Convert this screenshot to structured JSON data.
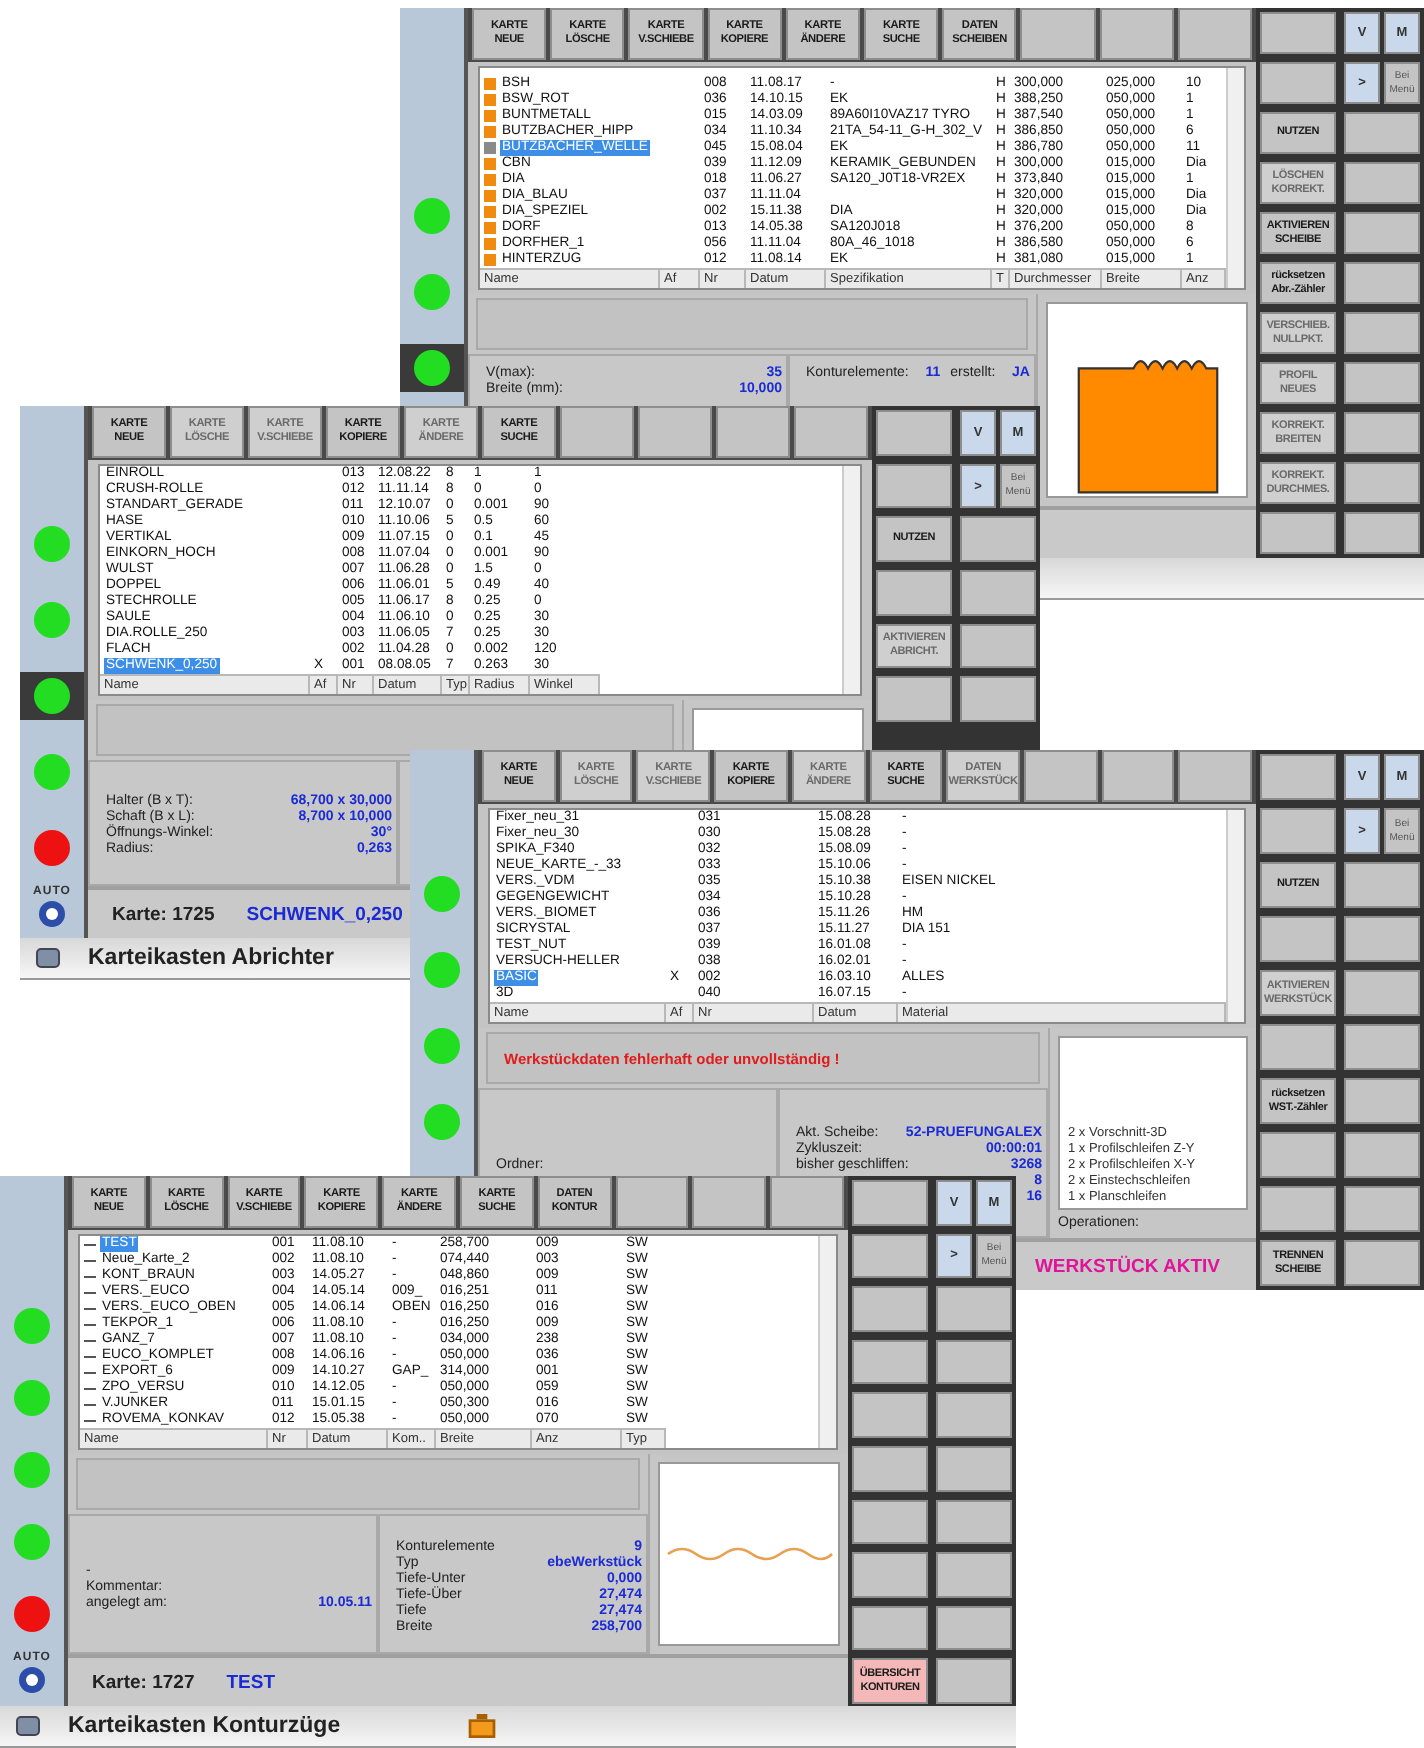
{
  "windows": [
    {
      "lights": [
        {
          "color": "#22dd22",
          "active": false
        },
        {
          "color": "#22dd22",
          "active": false
        },
        {
          "color": "#22dd22",
          "active": true
        }
      ],
      "panels": [
        {
          "rows": [
            [
              {
                "label": "V(max):",
                "value": "35"
              }
            ],
            [
              {
                "label": "Breite (mm):",
                "value": "10,000"
              }
            ]
          ]
        },
        {
          "rows": [
            [
              {
                "label": "Konturelemente:",
                "value": "11"
              },
              {
                "label": "erstellt:",
                "value": "JA"
              }
            ]
          ]
        }
      ],
      "drawing": {
        "kind": "profile"
      },
      "table": {
        "rows": [
          {
            "cells": [
              "BSH",
              null,
              "008",
              "11.08.17",
              "-",
              "H",
              "300,000",
              "025,000",
              "10"
            ],
            "selected": false
          },
          {
            "cells": [
              "BSW_ROT",
              null,
              "036",
              "14.10.15",
              "EK",
              "H",
              "388,250",
              "050,000",
              "1"
            ],
            "selected": false
          },
          {
            "cells": [
              "BUNTMETALL",
              null,
              "015",
              "14.03.09",
              "89A60I10VAZ17 TYRO",
              "H",
              "387,540",
              "050,000",
              "1"
            ],
            "selected": false
          },
          {
            "cells": [
              "BUTZBACHER_HIPP",
              null,
              "034",
              "11.10.34",
              "21TA_54-11_G-H_302_V",
              "H",
              "386,850",
              "050,000",
              "6"
            ],
            "selected": false
          },
          {
            "cells": [
              "BUTZBACHER_WELLE",
              null,
              "045",
              "15.08.04",
              "EK",
              "H",
              "386,780",
              "050,000",
              "11"
            ],
            "selected": true
          },
          {
            "cells": [
              "CBN",
              null,
              "039",
              "11.12.09",
              "KERAMIK_GEBUNDEN",
              "H",
              "300,000",
              "015,000",
              "Dia"
            ],
            "selected": false
          },
          {
            "cells": [
              "DIA",
              null,
              "018",
              "11.06.27",
              "SA120_J0T18-VR2EX",
              "H",
              "373,840",
              "015,000",
              "1"
            ],
            "selected": false
          },
          {
            "cells": [
              "DIA_BLAU",
              null,
              "037",
              "11.11.04",
              null,
              "H",
              "320,000",
              "015,000",
              "Dia"
            ],
            "selected": false
          },
          {
            "cells": [
              "DIA_SPEZIEL",
              null,
              "002",
              "15.11.38",
              "DIA",
              "H",
              "320,000",
              "015,000",
              "Dia"
            ],
            "selected": false
          },
          {
            "cells": [
              "DORF",
              null,
              "013",
              "14.05.38",
              "SA120J018",
              "H",
              "376,200",
              "050,000",
              "8"
            ],
            "selected": false
          },
          {
            "cells": [
              "DORFHER_1",
              null,
              "056",
              "11.11.04",
              "80A_46_1018",
              "H",
              "386,580",
              "050,000",
              "6"
            ],
            "selected": false
          },
          {
            "cells": [
              "HINTERZUG",
              null,
              "012",
              "11.08.14",
              "EK",
              "H",
              "381,080",
              "015,000",
              "1"
            ],
            "selected": false
          }
        ],
        "heading_row": [
          "Name",
          "Af",
          "Nr",
          "Datum",
          "Spezifikation",
          "T",
          "Durchmesser",
          "Breite",
          "Anz"
        ]
      },
      "toolbar": [
        {
          "label": "KARTE\nNEUE",
          "disabled": false
        },
        {
          "label": "KARTE\nLÖSCHE",
          "disabled": false
        },
        {
          "label": "KARTE\nV.SCHIEBE",
          "disabled": false
        },
        {
          "label": "KARTE\nKOPIERE",
          "disabled": false
        },
        {
          "label": "KARTE\nÄNDERE",
          "disabled": false
        },
        {
          "label": "KARTE\nSUCHE",
          "disabled": false
        },
        {
          "label": "DATEN\nSCHEIBEN",
          "disabled": false
        }
      ],
      "side_buttons": [
        {
          "kind": "blank"
        },
        {
          "kind": "blank"
        },
        {
          "kind": "button",
          "label": "NUTZEN",
          "disabled": false
        },
        {
          "kind": "button",
          "label": "LÖSCHEN\nKORREKT.",
          "disabled": true
        },
        {
          "kind": "button",
          "label": "AKTIVIEREN\nSCHEIBE",
          "disabled": false
        },
        {
          "kind": "button",
          "label": "rücksetzen\nAbr.-Zähler",
          "disabled": false
        },
        {
          "kind": "button",
          "label": "VERSCHIEB.\nNULLPKT.",
          "disabled": true
        },
        {
          "kind": "button",
          "label": "PROFIL\nNEUES",
          "disabled": true
        },
        {
          "kind": "button",
          "label": "KORREKT.\nBREITEN",
          "disabled": true
        },
        {
          "kind": "button",
          "label": "KORREKT.\nDURCHMES.",
          "disabled": true
        },
        {
          "kind": "blank"
        }
      ],
      "nav": {
        "keys": [
          "V",
          "M"
        ],
        "arrow": ">",
        "menu": "Bei\nMenü"
      }
    },
    {
      "lights": [
        {
          "color": "#22dd22",
          "active": false
        },
        {
          "color": "#22dd22",
          "active": false
        },
        {
          "color": "#22dd22",
          "active": true
        },
        {
          "color": "#22dd22",
          "active": false
        },
        {
          "color": "#ee1111",
          "active": false
        }
      ],
      "mode": "AUTO",
      "panels": [
        {
          "rows": [
            [
              {
                "label": "Halter (B x T):",
                "value": "68,700 x 30,000"
              }
            ],
            [
              {
                "label": "Schaft (B x L):",
                "value": "8,700 x 10,000"
              }
            ],
            [
              {
                "label": "Öffnungs-Winkel:",
                "value": "30°"
              }
            ],
            [
              {
                "label": "Radius:",
                "value": "0,263"
              }
            ]
          ]
        }
      ],
      "drawing": {
        "kind": "frame"
      },
      "table": {
        "rows": [
          {
            "cells": [
              "EINROLL",
              null,
              "013",
              "12.08.22",
              "8",
              "1",
              "1"
            ],
            "selected": false
          },
          {
            "cells": [
              "CRUSH-ROLLE",
              null,
              "012",
              "11.11.14",
              "8",
              "0",
              "0"
            ],
            "selected": false
          },
          {
            "cells": [
              "STANDART_GERADE",
              null,
              "011",
              "12.10.07",
              "0",
              "0.001",
              "90"
            ],
            "selected": false
          },
          {
            "cells": [
              "HASE",
              null,
              "010",
              "11.10.06",
              "5",
              "0.5",
              "60"
            ],
            "selected": false
          },
          {
            "cells": [
              "VERTIKAL",
              null,
              "009",
              "11.07.15",
              "0",
              "0.1",
              "45"
            ],
            "selected": false
          },
          {
            "cells": [
              "EINKORN_HOCH",
              null,
              "008",
              "11.07.04",
              "0",
              "0.001",
              "90"
            ],
            "selected": false
          },
          {
            "cells": [
              "WULST",
              null,
              "007",
              "11.06.28",
              "0",
              "1.5",
              "0"
            ],
            "selected": false
          },
          {
            "cells": [
              "DOPPEL",
              null,
              "006",
              "11.06.01",
              "5",
              "0.49",
              "40"
            ],
            "selected": false
          },
          {
            "cells": [
              "STECHROLLE",
              null,
              "005",
              "11.06.17",
              "8",
              "0.25",
              "0"
            ],
            "selected": false
          },
          {
            "cells": [
              "SAULE",
              null,
              "004",
              "11.06.10",
              "0",
              "0.25",
              "30"
            ],
            "selected": false
          },
          {
            "cells": [
              "DIA.ROLLE_250",
              null,
              "003",
              "11.06.05",
              "7",
              "0.25",
              "30"
            ],
            "selected": false
          },
          {
            "cells": [
              "FLACH",
              null,
              "002",
              "11.04.28",
              "0",
              "0.002",
              "120"
            ],
            "selected": false
          },
          {
            "cells": [
              "SCHWENK_0,250",
              "X",
              "001",
              "08.08.05",
              "7",
              "0.263",
              "30"
            ],
            "selected": true
          }
        ],
        "heading_row": [
          "Name",
          "Af",
          "Nr",
          "Datum",
          "Typ",
          "Radius",
          "Winkel"
        ]
      },
      "toolbar": [
        {
          "label": "KARTE\nNEUE",
          "disabled": false
        },
        {
          "label": "KARTE\nLÖSCHE",
          "disabled": true
        },
        {
          "label": "KARTE\nV.SCHIEBE",
          "disabled": true
        },
        {
          "label": "KARTE\nKOPIERE",
          "disabled": false
        },
        {
          "label": "KARTE\nÄNDERE",
          "disabled": true
        },
        {
          "label": "KARTE\nSUCHE",
          "disabled": false
        }
      ],
      "side_buttons": [
        {
          "kind": "blank"
        },
        {
          "kind": "blank"
        },
        {
          "kind": "button",
          "label": "NUTZEN",
          "disabled": false
        },
        {
          "kind": "blank"
        },
        {
          "kind": "button",
          "label": "AKTIVIEREN\nABRICHT.",
          "disabled": true
        },
        {
          "kind": "blank"
        }
      ],
      "nav": {
        "keys": [
          "V",
          "M"
        ],
        "arrow": ">",
        "menu": "Bei\nMenü"
      },
      "card": {
        "label": "Karte: 1725",
        "name": "SCHWENK_0,250"
      },
      "title": {
        "text": "Karteikasten Abrichter"
      }
    },
    {
      "lights": [
        {
          "color": "#22dd22",
          "active": false
        },
        {
          "color": "#22dd22",
          "active": false
        },
        {
          "color": "#22dd22",
          "active": false
        },
        {
          "color": "#22dd22",
          "active": false
        }
      ],
      "table": {
        "rows": [
          {
            "cells": [
              "Fixer_neu_31",
              null,
              "031",
              "15.08.28",
              "-"
            ],
            "selected": false
          },
          {
            "cells": [
              "Fixer_neu_30",
              null,
              "030",
              "15.08.28",
              "-"
            ],
            "selected": false
          },
          {
            "cells": [
              "SPIKA_F340",
              null,
              "032",
              "15.08.09",
              "-"
            ],
            "selected": false
          },
          {
            "cells": [
              "NEUE_KARTE_-_33",
              null,
              "033",
              "15.10.06",
              "-"
            ],
            "selected": false
          },
          {
            "cells": [
              "VERS._VDM",
              null,
              "035",
              "15.10.38",
              "EISEN NICKEL"
            ],
            "selected": false
          },
          {
            "cells": [
              "GEGENGEWICHT",
              null,
              "034",
              "15.10.28",
              "-"
            ],
            "selected": false
          },
          {
            "cells": [
              "VERS._BIOMET",
              null,
              "036",
              "15.11.26",
              "HM"
            ],
            "selected": false
          },
          {
            "cells": [
              "SICRYSTAL",
              null,
              "037",
              "15.11.27",
              "DIA 151"
            ],
            "selected": false
          },
          {
            "cells": [
              "TEST_NUT",
              null,
              "039",
              "16.01.08",
              "-"
            ],
            "selected": false
          },
          {
            "cells": [
              "VERSUCH-HELLER",
              null,
              "038",
              "16.02.01",
              "-"
            ],
            "selected": false
          },
          {
            "cells": [
              "BASIC",
              "X",
              "002",
              "16.03.10",
              "ALLES"
            ],
            "selected": true
          },
          {
            "cells": [
              "3D",
              null,
              "040",
              "16.07.15",
              "-"
            ],
            "selected": false
          }
        ],
        "heading_row": [
          "Name",
          "Af",
          "Nr",
          "Datum",
          "Material"
        ]
      },
      "message": "Werkstückdaten fehlerhaft oder unvollständig !",
      "panels": [
        {
          "rows": [
            [
              {
                "label": "Ordner:"
              }
            ]
          ]
        },
        {
          "rows": [
            [
              {
                "label": "Akt. Scheibe:",
                "value": "52-PRUEFUNGALEX"
              }
            ],
            [
              {
                "label": "Zykluszeit:",
                "value": "00:00:01"
              }
            ],
            [
              {
                "label": "bisher geschliffen:",
                "value": "3268"
              }
            ],
            [
              {
                "value": "8"
              }
            ],
            [
              {
                "value": "16"
              }
            ]
          ]
        }
      ],
      "drawing": {
        "kind": "operations",
        "lines": [
          "2 x Vorschnitt-3D",
          "1 x Profilschleifen Z-Y",
          "2 x Profilschleifen X-Y",
          "2 x Einstechschleifen",
          "1 x Planschleifen"
        ],
        "label": "Operationen:"
      },
      "toolbar": [
        {
          "label": "KARTE\nNEUE",
          "disabled": false
        },
        {
          "label": "KARTE\nLÖSCHE",
          "disabled": true
        },
        {
          "label": "KARTE\nV.SCHIEBE",
          "disabled": true
        },
        {
          "label": "KARTE\nKOPIERE",
          "disabled": false
        },
        {
          "label": "KARTE\nÄNDERE",
          "disabled": true
        },
        {
          "label": "KARTE\nSUCHE",
          "disabled": false
        },
        {
          "label": "DATEN\nWERKSTÜCK",
          "disabled": true
        }
      ],
      "side_buttons": [
        {
          "kind": "blank"
        },
        {
          "kind": "blank"
        },
        {
          "kind": "button",
          "label": "NUTZEN",
          "disabled": false
        },
        {
          "kind": "blank"
        },
        {
          "kind": "button",
          "label": "AKTIVIEREN\nWERKSTÜCK",
          "disabled": true
        },
        {
          "kind": "blank"
        },
        {
          "kind": "button",
          "label": "rücksetzen\nWST.-Zähler",
          "disabled": false
        },
        {
          "kind": "blank"
        },
        {
          "kind": "blank"
        },
        {
          "kind": "button",
          "label": "TRENNEN\nSCHEIBE",
          "disabled": false
        }
      ],
      "nav": {
        "keys": [
          "V",
          "M"
        ],
        "arrow": ">",
        "menu": "Bei\nMenü"
      },
      "card": {
        "status": "WERKSTÜCK AKTIV"
      }
    },
    {
      "lights": [
        {
          "color": "#22dd22",
          "active": false
        },
        {
          "color": "#22dd22",
          "active": false
        },
        {
          "color": "#22dd22",
          "active": false
        },
        {
          "color": "#22dd22",
          "active": false
        },
        {
          "color": "#ee1111",
          "active": false
        }
      ],
      "mode": "AUTO",
      "table": {
        "rows": [
          {
            "cells": [
              "TEST",
              "001",
              "11.08.10",
              "-",
              "258,700",
              "009",
              "SW"
            ],
            "selected": true
          },
          {
            "cells": [
              "Neue_Karte_2",
              "002",
              "11.08.10",
              "-",
              "074,440",
              "003",
              "SW"
            ],
            "selected": false
          },
          {
            "cells": [
              "KONT_BRAUN",
              "003",
              "14.05.27",
              "-",
              "048,860",
              "009",
              "SW"
            ],
            "selected": false
          },
          {
            "cells": [
              "VERS._EUCO",
              "004",
              "14.05.14",
              "009_",
              "016,251",
              "011",
              "SW"
            ],
            "selected": false
          },
          {
            "cells": [
              "VERS._EUCO_OBEN",
              "005",
              "14.06.14",
              "OBEN",
              "016,250",
              "016",
              "SW"
            ],
            "selected": false
          },
          {
            "cells": [
              "TEKPOR_1",
              "006",
              "11.08.10",
              "-",
              "016,250",
              "009",
              "SW"
            ],
            "selected": false
          },
          {
            "cells": [
              "GANZ_7",
              "007",
              "11.08.10",
              "-",
              "034,000",
              "238",
              "SW"
            ],
            "selected": false
          },
          {
            "cells": [
              "EUCO_KOMPLET",
              "008",
              "14.06.16",
              "-",
              "050,000",
              "036",
              "SW"
            ],
            "selected": false
          },
          {
            "cells": [
              "EXPORT_6",
              "009",
              "14.10.27",
              "GAP_",
              "314,000",
              "001",
              "SW"
            ],
            "selected": false
          },
          {
            "cells": [
              "ZPO_VERSU",
              "010",
              "14.12.05",
              "-",
              "050,000",
              "059",
              "SW"
            ],
            "selected": false
          },
          {
            "cells": [
              "V.JUNKER",
              "011",
              "15.01.15",
              "-",
              "050,300",
              "016",
              "SW"
            ],
            "selected": false
          },
          {
            "cells": [
              "ROVEMA_KONKAV",
              "012",
              "15.05.38",
              "-",
              "050,000",
              "070",
              "SW"
            ],
            "selected": false
          }
        ],
        "heading_row": [
          "Name",
          "Nr",
          "Datum",
          "Kom..",
          "Breite",
          "Anz",
          "Typ"
        ]
      },
      "panels": [
        {
          "rows": [
            [
              {
                "label": "-"
              }
            ],
            [
              {
                "label": "Kommentar:"
              }
            ],
            [
              {
                "label": "angelegt am:",
                "value": "10.05.11"
              }
            ]
          ]
        },
        {
          "rows": [
            [
              {
                "label": "Konturelemente",
                "value": "9"
              }
            ],
            [
              {
                "label": "Typ",
                "value": "ebeWerkstück"
              }
            ],
            [
              {
                "label": "Tiefe-Unter",
                "value": "0,000"
              }
            ],
            [
              {
                "label": "Tiefe-Über",
                "value": "27,474"
              }
            ],
            [
              {
                "label": "Tiefe",
                "value": "27,474"
              }
            ],
            [
              {
                "label": "Breite",
                "value": "258,700"
              }
            ]
          ]
        }
      ],
      "drawing": {
        "kind": "wave"
      },
      "toolbar": [
        {
          "label": "KARTE\nNEUE",
          "disabled": false
        },
        {
          "label": "KARTE\nLÖSCHE",
          "disabled": false
        },
        {
          "label": "KARTE\nV.SCHIEBE",
          "disabled": false
        },
        {
          "label": "KARTE\nKOPIERE",
          "disabled": false
        },
        {
          "label": "KARTE\nÄNDERE",
          "disabled": false
        },
        {
          "label": "KARTE\nSUCHE",
          "disabled": false
        },
        {
          "label": "DATEN\nKONTUR",
          "disabled": false
        }
      ],
      "side_buttons": [
        {
          "kind": "blank"
        },
        {
          "kind": "blank"
        },
        {
          "kind": "blank"
        },
        {
          "kind": "blank"
        },
        {
          "kind": "blank"
        },
        {
          "kind": "blank"
        },
        {
          "kind": "blank"
        },
        {
          "kind": "blank"
        },
        {
          "kind": "blank"
        },
        {
          "kind": "accent",
          "label": "ÜBERSICHT\nKONTUREN",
          "disabled": false
        }
      ],
      "nav": {
        "keys": [
          "V",
          "M"
        ],
        "arrow": ">",
        "menu": "Bei\nMenü"
      },
      "card": {
        "label": "Karte: 1727",
        "name": "TEST"
      },
      "title": {
        "text": "Karteikasten Konturzüge",
        "flag": true
      }
    }
  ]
}
